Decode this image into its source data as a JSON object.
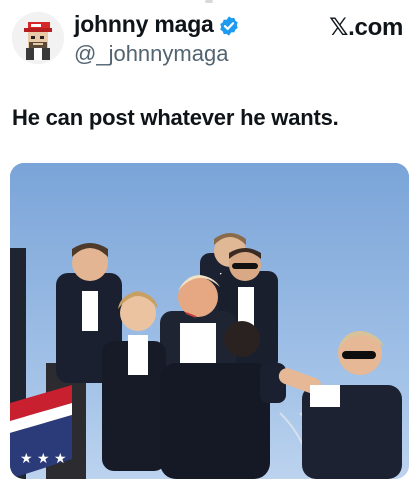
{
  "post": {
    "author": {
      "display_name": "johnny maga",
      "handle": "@_johnnymaga",
      "verified": true
    },
    "site_label": "𝕏.com",
    "text": "He can post whatever he wants.",
    "media": {
      "icon": "photo-icon"
    }
  },
  "colors": {
    "verified_badge": "#1d9bf0",
    "handle_gray": "#536471",
    "sky": "#8fb4df"
  }
}
